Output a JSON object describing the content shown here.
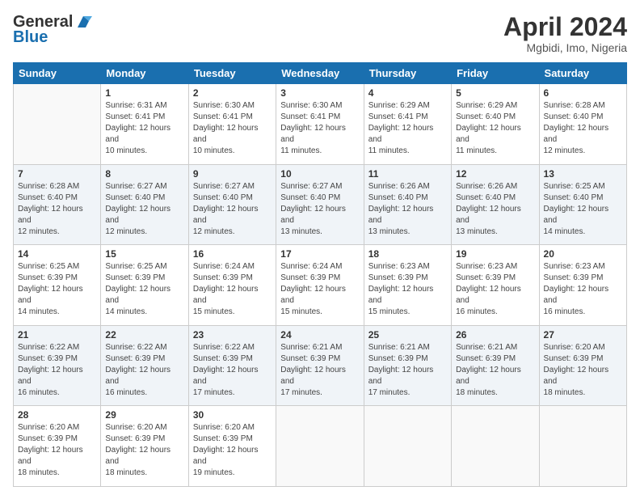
{
  "header": {
    "logo_line1": "General",
    "logo_line2": "Blue",
    "month_year": "April 2024",
    "location": "Mgbidi, Imo, Nigeria"
  },
  "days_of_week": [
    "Sunday",
    "Monday",
    "Tuesday",
    "Wednesday",
    "Thursday",
    "Friday",
    "Saturday"
  ],
  "weeks": [
    [
      {
        "day": "",
        "sunrise": "",
        "sunset": "",
        "daylight": ""
      },
      {
        "day": "1",
        "sunrise": "Sunrise: 6:31 AM",
        "sunset": "Sunset: 6:41 PM",
        "daylight": "Daylight: 12 hours and 10 minutes."
      },
      {
        "day": "2",
        "sunrise": "Sunrise: 6:30 AM",
        "sunset": "Sunset: 6:41 PM",
        "daylight": "Daylight: 12 hours and 10 minutes."
      },
      {
        "day": "3",
        "sunrise": "Sunrise: 6:30 AM",
        "sunset": "Sunset: 6:41 PM",
        "daylight": "Daylight: 12 hours and 11 minutes."
      },
      {
        "day": "4",
        "sunrise": "Sunrise: 6:29 AM",
        "sunset": "Sunset: 6:41 PM",
        "daylight": "Daylight: 12 hours and 11 minutes."
      },
      {
        "day": "5",
        "sunrise": "Sunrise: 6:29 AM",
        "sunset": "Sunset: 6:40 PM",
        "daylight": "Daylight: 12 hours and 11 minutes."
      },
      {
        "day": "6",
        "sunrise": "Sunrise: 6:28 AM",
        "sunset": "Sunset: 6:40 PM",
        "daylight": "Daylight: 12 hours and 12 minutes."
      }
    ],
    [
      {
        "day": "7",
        "sunrise": "Sunrise: 6:28 AM",
        "sunset": "Sunset: 6:40 PM",
        "daylight": "Daylight: 12 hours and 12 minutes."
      },
      {
        "day": "8",
        "sunrise": "Sunrise: 6:27 AM",
        "sunset": "Sunset: 6:40 PM",
        "daylight": "Daylight: 12 hours and 12 minutes."
      },
      {
        "day": "9",
        "sunrise": "Sunrise: 6:27 AM",
        "sunset": "Sunset: 6:40 PM",
        "daylight": "Daylight: 12 hours and 12 minutes."
      },
      {
        "day": "10",
        "sunrise": "Sunrise: 6:27 AM",
        "sunset": "Sunset: 6:40 PM",
        "daylight": "Daylight: 12 hours and 13 minutes."
      },
      {
        "day": "11",
        "sunrise": "Sunrise: 6:26 AM",
        "sunset": "Sunset: 6:40 PM",
        "daylight": "Daylight: 12 hours and 13 minutes."
      },
      {
        "day": "12",
        "sunrise": "Sunrise: 6:26 AM",
        "sunset": "Sunset: 6:40 PM",
        "daylight": "Daylight: 12 hours and 13 minutes."
      },
      {
        "day": "13",
        "sunrise": "Sunrise: 6:25 AM",
        "sunset": "Sunset: 6:40 PM",
        "daylight": "Daylight: 12 hours and 14 minutes."
      }
    ],
    [
      {
        "day": "14",
        "sunrise": "Sunrise: 6:25 AM",
        "sunset": "Sunset: 6:39 PM",
        "daylight": "Daylight: 12 hours and 14 minutes."
      },
      {
        "day": "15",
        "sunrise": "Sunrise: 6:25 AM",
        "sunset": "Sunset: 6:39 PM",
        "daylight": "Daylight: 12 hours and 14 minutes."
      },
      {
        "day": "16",
        "sunrise": "Sunrise: 6:24 AM",
        "sunset": "Sunset: 6:39 PM",
        "daylight": "Daylight: 12 hours and 15 minutes."
      },
      {
        "day": "17",
        "sunrise": "Sunrise: 6:24 AM",
        "sunset": "Sunset: 6:39 PM",
        "daylight": "Daylight: 12 hours and 15 minutes."
      },
      {
        "day": "18",
        "sunrise": "Sunrise: 6:23 AM",
        "sunset": "Sunset: 6:39 PM",
        "daylight": "Daylight: 12 hours and 15 minutes."
      },
      {
        "day": "19",
        "sunrise": "Sunrise: 6:23 AM",
        "sunset": "Sunset: 6:39 PM",
        "daylight": "Daylight: 12 hours and 16 minutes."
      },
      {
        "day": "20",
        "sunrise": "Sunrise: 6:23 AM",
        "sunset": "Sunset: 6:39 PM",
        "daylight": "Daylight: 12 hours and 16 minutes."
      }
    ],
    [
      {
        "day": "21",
        "sunrise": "Sunrise: 6:22 AM",
        "sunset": "Sunset: 6:39 PM",
        "daylight": "Daylight: 12 hours and 16 minutes."
      },
      {
        "day": "22",
        "sunrise": "Sunrise: 6:22 AM",
        "sunset": "Sunset: 6:39 PM",
        "daylight": "Daylight: 12 hours and 16 minutes."
      },
      {
        "day": "23",
        "sunrise": "Sunrise: 6:22 AM",
        "sunset": "Sunset: 6:39 PM",
        "daylight": "Daylight: 12 hours and 17 minutes."
      },
      {
        "day": "24",
        "sunrise": "Sunrise: 6:21 AM",
        "sunset": "Sunset: 6:39 PM",
        "daylight": "Daylight: 12 hours and 17 minutes."
      },
      {
        "day": "25",
        "sunrise": "Sunrise: 6:21 AM",
        "sunset": "Sunset: 6:39 PM",
        "daylight": "Daylight: 12 hours and 17 minutes."
      },
      {
        "day": "26",
        "sunrise": "Sunrise: 6:21 AM",
        "sunset": "Sunset: 6:39 PM",
        "daylight": "Daylight: 12 hours and 18 minutes."
      },
      {
        "day": "27",
        "sunrise": "Sunrise: 6:20 AM",
        "sunset": "Sunset: 6:39 PM",
        "daylight": "Daylight: 12 hours and 18 minutes."
      }
    ],
    [
      {
        "day": "28",
        "sunrise": "Sunrise: 6:20 AM",
        "sunset": "Sunset: 6:39 PM",
        "daylight": "Daylight: 12 hours and 18 minutes."
      },
      {
        "day": "29",
        "sunrise": "Sunrise: 6:20 AM",
        "sunset": "Sunset: 6:39 PM",
        "daylight": "Daylight: 12 hours and 18 minutes."
      },
      {
        "day": "30",
        "sunrise": "Sunrise: 6:20 AM",
        "sunset": "Sunset: 6:39 PM",
        "daylight": "Daylight: 12 hours and 19 minutes."
      },
      {
        "day": "",
        "sunrise": "",
        "sunset": "",
        "daylight": ""
      },
      {
        "day": "",
        "sunrise": "",
        "sunset": "",
        "daylight": ""
      },
      {
        "day": "",
        "sunrise": "",
        "sunset": "",
        "daylight": ""
      },
      {
        "day": "",
        "sunrise": "",
        "sunset": "",
        "daylight": ""
      }
    ]
  ]
}
